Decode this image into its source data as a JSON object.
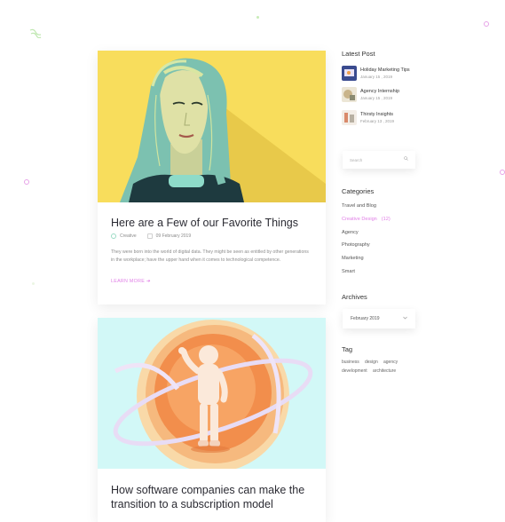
{
  "posts": [
    {
      "title": "Here are a Few of our Favorite Things",
      "category": "Creative",
      "date": "09 February 2019",
      "excerpt": "They were born into the world of digital data. They might be seen as entitled by other generations in the workplace; have the upper hand when it comes to technological competence.",
      "cta": "LEARN MORE",
      "cta_arrow": "➔"
    },
    {
      "title": "How software companies can make the transition to a subscription model"
    }
  ],
  "sidebar": {
    "latest_post_heading": "Latest Post",
    "latest_posts": [
      {
        "title": "Holiday Marketing Tips",
        "date": "January 15 , 2019"
      },
      {
        "title": "Agency Internship",
        "date": "January 15 , 2019"
      },
      {
        "title": "Thirsty Insights",
        "date": "February 13 , 2019"
      }
    ],
    "search_placeholder": "Search",
    "categories_heading": "Categories",
    "categories": [
      {
        "label": "Travel and Blog"
      },
      {
        "label": "Creative Design",
        "count": "(12)",
        "active": true
      },
      {
        "label": "Agency"
      },
      {
        "label": "Photography"
      },
      {
        "label": "Marketing"
      },
      {
        "label": "Smart"
      }
    ],
    "archives_heading": "Archives",
    "archive_selected": "February 2019",
    "tag_heading": "Tag",
    "tags": [
      "business",
      "design",
      "agency",
      "development",
      "architecture"
    ]
  },
  "colors": {
    "accent": "#e07ee6",
    "hero1_bg": "#f8dd5c",
    "hero2_bg": "#d2f8f7"
  }
}
